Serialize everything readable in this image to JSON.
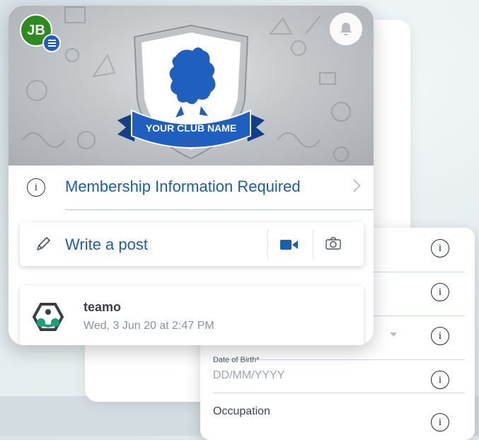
{
  "header": {
    "avatar_initials": "JB",
    "club_name": "YOUR CLUB NAME",
    "club_est": "EST 0000",
    "icons": {
      "menu": "menu-icon",
      "notifications": "bell-icon"
    }
  },
  "membership": {
    "text": "Membership Information Required",
    "icon": "info-icon"
  },
  "composer": {
    "placeholder": "Write a post",
    "icons": [
      "pencil-icon",
      "video-icon",
      "camera-icon"
    ]
  },
  "post": {
    "author": "teamo",
    "timestamp": "Wed, 3 Jun 20 at 2:47 PM"
  },
  "form": {
    "fields": [
      {
        "label": "",
        "placeholder": "",
        "value": ""
      },
      {
        "label": "",
        "placeholder": "",
        "value": ""
      },
      {
        "label": "",
        "placeholder": "",
        "value": "",
        "dropdown": true
      },
      {
        "label": "Date of Birth*",
        "placeholder": "DD/MM/YYYY",
        "value": ""
      },
      {
        "label": "",
        "placeholder": "",
        "value": "Occupation"
      }
    ],
    "info_symbol": "i"
  },
  "colors": {
    "accent": "#1b5eab",
    "avatar": "#2e8b1f",
    "menu_badge": "#1f5fbf",
    "crest_blue": "#1f5fbf"
  }
}
